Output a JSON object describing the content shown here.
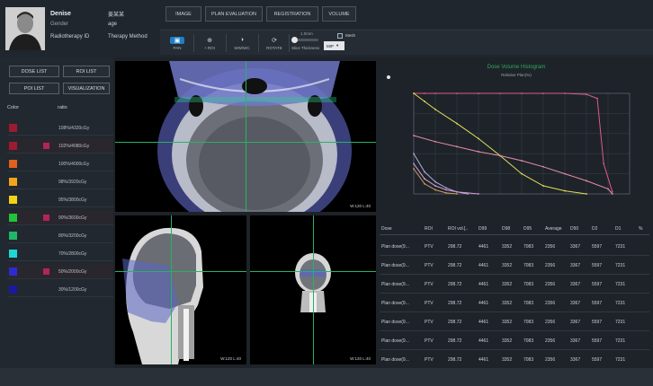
{
  "patient": {
    "name": "Denise",
    "name_value": "姜某某",
    "gender_label": "Gender",
    "gender_value": "age",
    "rt_id_label": "Radiotherapy ID",
    "therapy_label": "Therapy Method"
  },
  "nav": [
    "IMAGE",
    "PLAN EVALUATION",
    "REGISTRATION",
    "VOLUME"
  ],
  "toolbar": {
    "tools": [
      {
        "icon": "pan-icon",
        "label": "PAN",
        "active": true
      },
      {
        "icon": "zoom-icon",
        "label": "+ ROI",
        "active": false
      },
      {
        "icon": "window-level-icon",
        "label": "WW/WC",
        "active": false
      },
      {
        "icon": "rotate-icon",
        "label": "ROTATE",
        "active": false
      }
    ],
    "slice_value": "1.0mm",
    "slice_label": "Slice Thickness",
    "mesh_label": "Mesh",
    "mip_value": "MIP"
  },
  "left": {
    "buttons": [
      "DOSE LIST",
      "ROI LIST",
      "POI LIST",
      "VISUALIZATION"
    ],
    "col_color": "Color",
    "col_ratio": "ratio",
    "doses": [
      {
        "color": "#9b1b30",
        "checked": false,
        "ratio": "108%/4320cGy"
      },
      {
        "color": "#9b1b30",
        "checked": true,
        "ratio": "102%/4080cGy"
      },
      {
        "color": "#e0621b",
        "checked": false,
        "ratio": "100%/4000cGy"
      },
      {
        "color": "#f2a51a",
        "checked": false,
        "ratio": "98%/3920cGy"
      },
      {
        "color": "#f2d21a",
        "checked": false,
        "ratio": "95%/3800cGy"
      },
      {
        "color": "#1fc43a",
        "checked": true,
        "ratio": "90%/3600cGy"
      },
      {
        "color": "#1fb86a",
        "checked": false,
        "ratio": "80%/3200cGy"
      },
      {
        "color": "#1fd6d6",
        "checked": false,
        "ratio": "70%/2800cGy"
      },
      {
        "color": "#2b2bd6",
        "checked": true,
        "ratio": "50%/2000cGy"
      },
      {
        "color": "#1a1a9e",
        "checked": false,
        "ratio": "30%/1200cGy"
      }
    ]
  },
  "viewers": {
    "axial_wl": "W:120 L:40",
    "sagittal_wl": "W:120 L:40",
    "coronal_wl": "W:120 L:40"
  },
  "chart_data": {
    "type": "line",
    "title": "Dose Volume Histogram",
    "subtitle": "Relative Plan(%)",
    "xlabel": "",
    "ylabel": "",
    "xlim": [
      0,
      100
    ],
    "ylim": [
      0,
      100
    ],
    "grid": true,
    "series": [
      {
        "color": "#e05a8a",
        "x": [
          0,
          5,
          10,
          20,
          30,
          40,
          50,
          60,
          70,
          80,
          85,
          88,
          92
        ],
        "y": [
          100,
          100,
          100,
          100,
          100,
          100,
          100,
          100,
          100,
          99,
          95,
          30,
          2
        ]
      },
      {
        "color": "#e0e05a",
        "x": [
          0,
          5,
          10,
          20,
          30,
          40,
          50,
          60,
          70,
          80
        ],
        "y": [
          100,
          92,
          84,
          70,
          55,
          38,
          20,
          8,
          3,
          0
        ]
      },
      {
        "color": "#e88fa8",
        "x": [
          0,
          10,
          20,
          30,
          40,
          50,
          60,
          70,
          80,
          90,
          92
        ],
        "y": [
          58,
          52,
          47,
          42,
          38,
          33,
          27,
          20,
          13,
          5,
          0
        ]
      },
      {
        "color": "#a8b0d8",
        "x": [
          0,
          5,
          10,
          15,
          20,
          25
        ],
        "y": [
          40,
          22,
          12,
          6,
          2,
          0
        ]
      },
      {
        "color": "#d89ad8",
        "x": [
          0,
          5,
          10,
          15,
          20,
          30
        ],
        "y": [
          30,
          15,
          8,
          4,
          2,
          0
        ]
      },
      {
        "color": "#c8a060",
        "x": [
          0,
          5,
          10,
          15,
          20
        ],
        "y": [
          25,
          10,
          4,
          1,
          0
        ]
      }
    ]
  },
  "table": {
    "headers": [
      "Dose",
      "ROI",
      "ROI vol.[..",
      "D99",
      "D98",
      "D95",
      "Average",
      "D50",
      "D2",
      "D1",
      "%"
    ],
    "rows": [
      [
        "Plan dose(9...",
        "PTV",
        "298.72",
        "4461",
        "3352",
        "7083",
        "2356",
        "3367",
        "5597",
        "7231",
        ""
      ],
      [
        "Plan dose(9...",
        "PTV",
        "298.72",
        "4461",
        "3352",
        "7083",
        "2356",
        "3367",
        "5597",
        "7231",
        ""
      ],
      [
        "Plan dose(9...",
        "PTV",
        "298.72",
        "4461",
        "3352",
        "7083",
        "2356",
        "3367",
        "5597",
        "7231",
        ""
      ],
      [
        "Plan dose(9...",
        "PTV",
        "298.72",
        "4461",
        "3352",
        "7083",
        "2356",
        "3367",
        "5597",
        "7231",
        ""
      ],
      [
        "Plan dose(9...",
        "PTV",
        "298.72",
        "4461",
        "3352",
        "7083",
        "2356",
        "3367",
        "5597",
        "7231",
        ""
      ],
      [
        "Plan dose(9...",
        "PTV",
        "298.72",
        "4461",
        "3352",
        "7083",
        "2356",
        "3367",
        "5597",
        "7231",
        ""
      ],
      [
        "Plan dose(9...",
        "PTV",
        "298.72",
        "4461",
        "3352",
        "7083",
        "2356",
        "3367",
        "5597",
        "7231",
        ""
      ]
    ]
  }
}
